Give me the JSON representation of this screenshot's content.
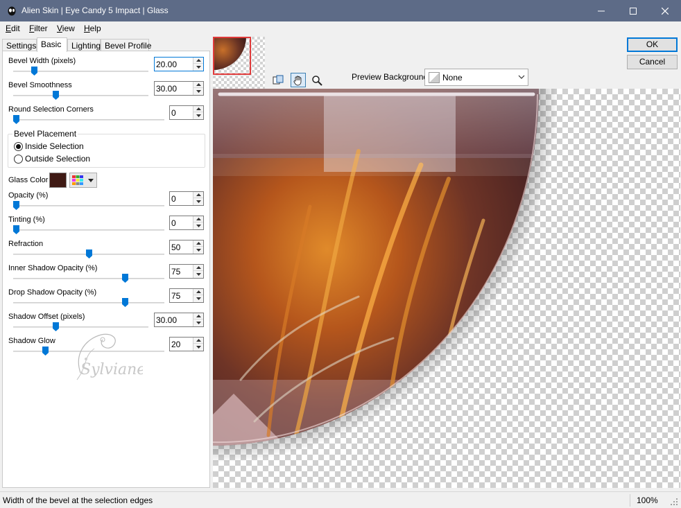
{
  "window": {
    "title": "Alien Skin | Eye Candy 5 Impact | Glass",
    "minimize_icon": "minimize-icon",
    "maximize_icon": "maximize-icon",
    "close_icon": "close-icon"
  },
  "menu": {
    "edit": {
      "hot": "E",
      "rest": "dit"
    },
    "filter": {
      "hot": "F",
      "rest": "ilter"
    },
    "view": {
      "hot": "V",
      "rest": "iew"
    },
    "help": {
      "hot": "H",
      "rest": "elp"
    }
  },
  "tabs": [
    "Settings",
    "Basic",
    "Lighting",
    "Bevel Profile"
  ],
  "active_tab": "Basic",
  "controls": {
    "bevel_width": {
      "label": "Bevel Width (pixels)",
      "value": "20.00",
      "position": 0.14
    },
    "bevel_smoothness": {
      "label": "Bevel Smoothness",
      "value": "30.00",
      "position": 0.3
    },
    "round_corners": {
      "label": "Round Selection Corners",
      "value": "0",
      "position": 0.0
    },
    "bevel_placement": {
      "title": "Bevel Placement",
      "inside": "Inside Selection",
      "outside": "Outside Selection",
      "selected": "Inside Selection"
    },
    "glass_color": {
      "label": "Glass Color",
      "color": "#3f1a14"
    },
    "opacity": {
      "label": "Opacity (%)",
      "value": "0",
      "position": 0.0
    },
    "tinting": {
      "label": "Tinting (%)",
      "value": "0",
      "position": 0.0
    },
    "refraction": {
      "label": "Refraction",
      "value": "50",
      "position": 0.5
    },
    "inner_shadow": {
      "label": "Inner Shadow Opacity (%)",
      "value": "75",
      "position": 0.75
    },
    "drop_shadow": {
      "label": "Drop Shadow Opacity (%)",
      "value": "75",
      "position": 0.75
    },
    "shadow_offset": {
      "label": "Shadow Offset (pixels)",
      "value": "30.00",
      "position": 0.3
    },
    "shadow_glow": {
      "label": "Shadow Glow",
      "value": "20",
      "position": 0.2
    }
  },
  "watermark_text": "Sylviane",
  "preview_background": {
    "label": "Preview Background:",
    "value": "None"
  },
  "buttons": {
    "ok": "OK",
    "cancel": "Cancel"
  },
  "tools": [
    "preview-compare-icon",
    "hand-pan-icon",
    "zoom-magnifier-icon"
  ],
  "status": {
    "text": "Width of the bevel at the selection edges",
    "zoom": "100%"
  },
  "colors": {
    "titlebar": "#5d6b87",
    "slider_thumb": "#0078d7",
    "accent": "#0078d7"
  }
}
